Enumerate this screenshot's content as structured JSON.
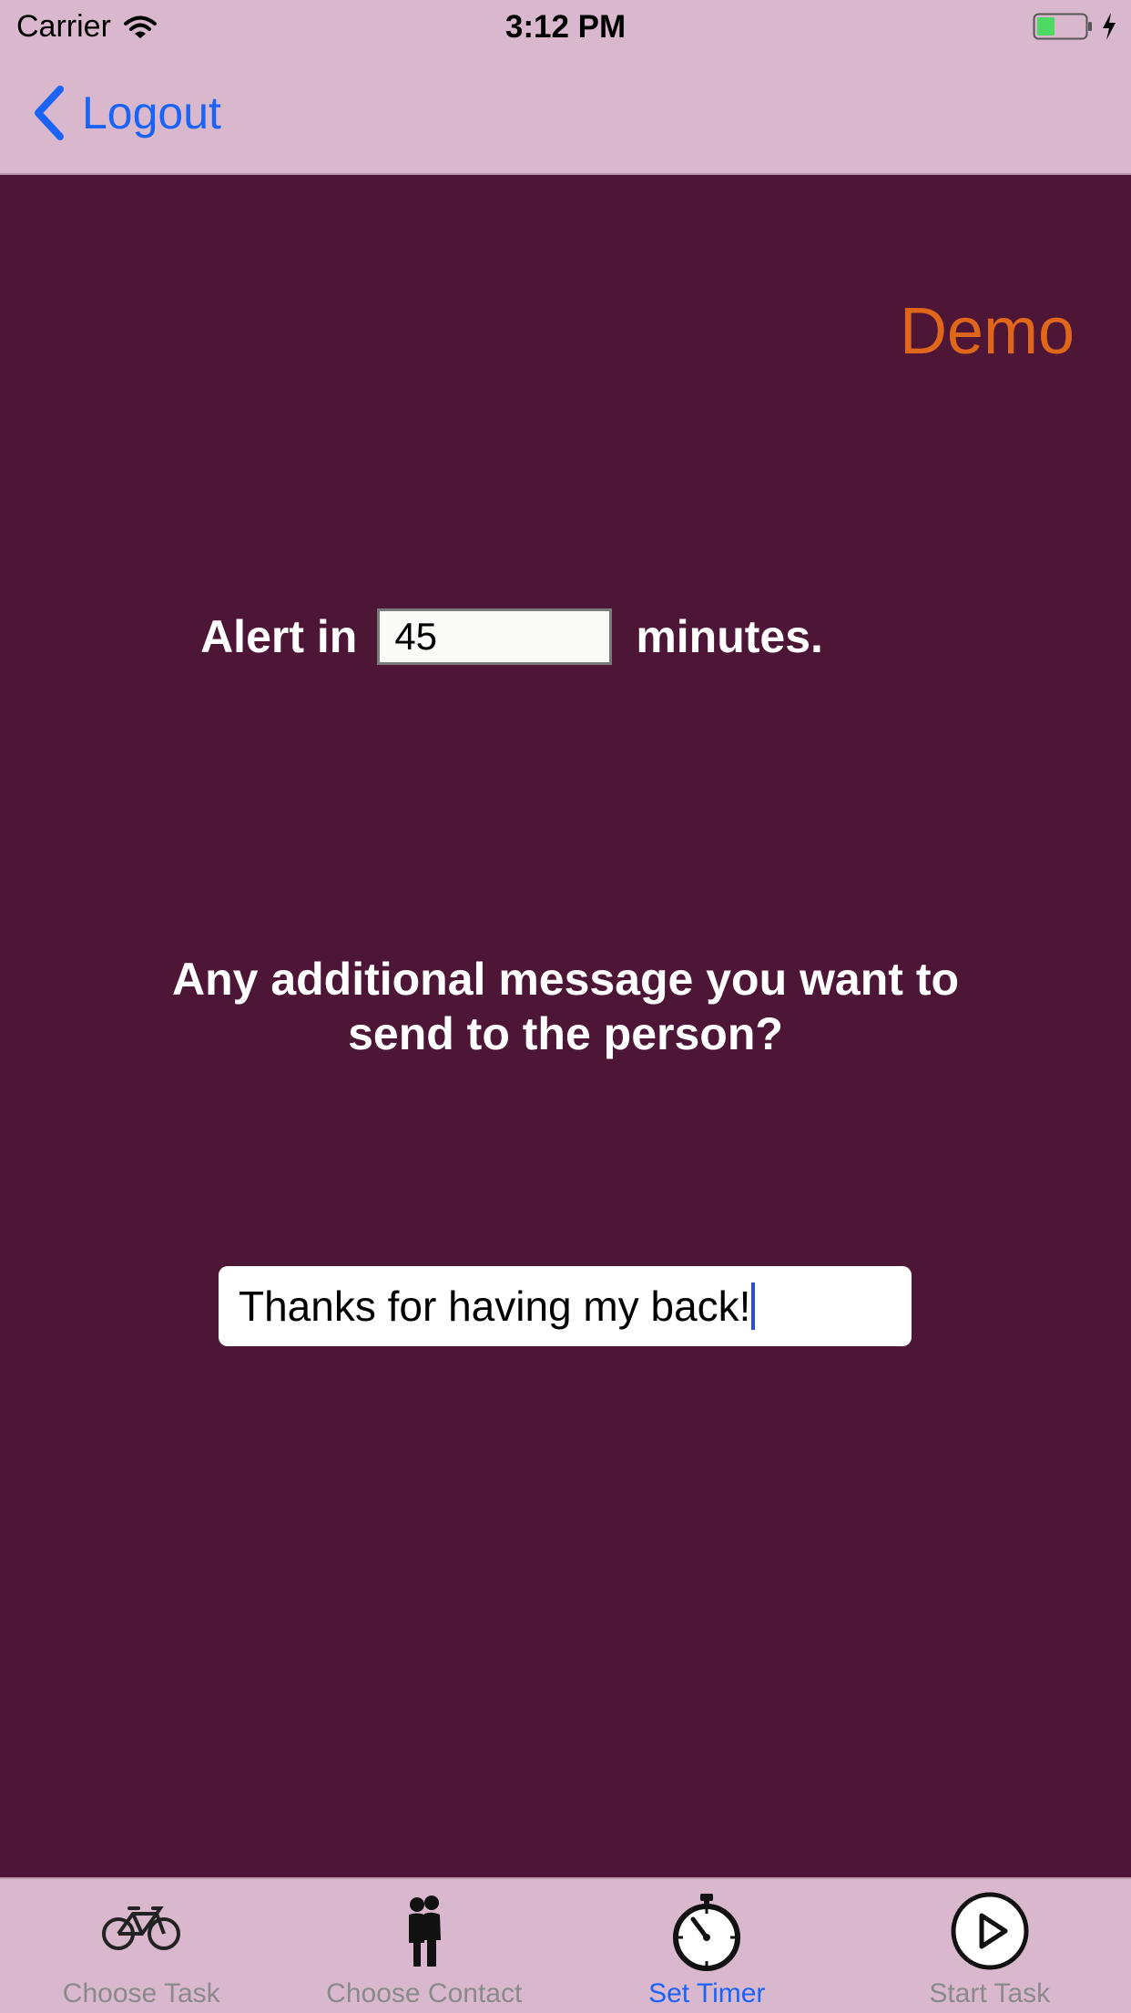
{
  "status_bar": {
    "carrier": "Carrier",
    "time": "3:12 PM",
    "battery_color": "#4cd964",
    "icons": [
      "wifi-icon",
      "battery-icon",
      "charging-icon"
    ]
  },
  "nav": {
    "back_label": "Logout",
    "back_icon": "chevron-left-icon",
    "accent_color": "#1a63f5"
  },
  "main": {
    "user_label": "Demo",
    "alert_prefix": "Alert in",
    "minutes_value": "45",
    "alert_suffix": "minutes.",
    "question_line1": "Any additional message you want to",
    "question_line2": "send to the person?",
    "message_value": "Thanks for having my back!",
    "background_color": "#4d1636",
    "demo_color": "#e0671a"
  },
  "tabs": [
    {
      "label": "Choose Task",
      "icon": "bicycle-icon",
      "active": false
    },
    {
      "label": "Choose Contact",
      "icon": "people-icon",
      "active": false
    },
    {
      "label": "Set Timer",
      "icon": "stopwatch-icon",
      "active": true
    },
    {
      "label": "Start Task",
      "icon": "play-icon",
      "active": false
    }
  ]
}
